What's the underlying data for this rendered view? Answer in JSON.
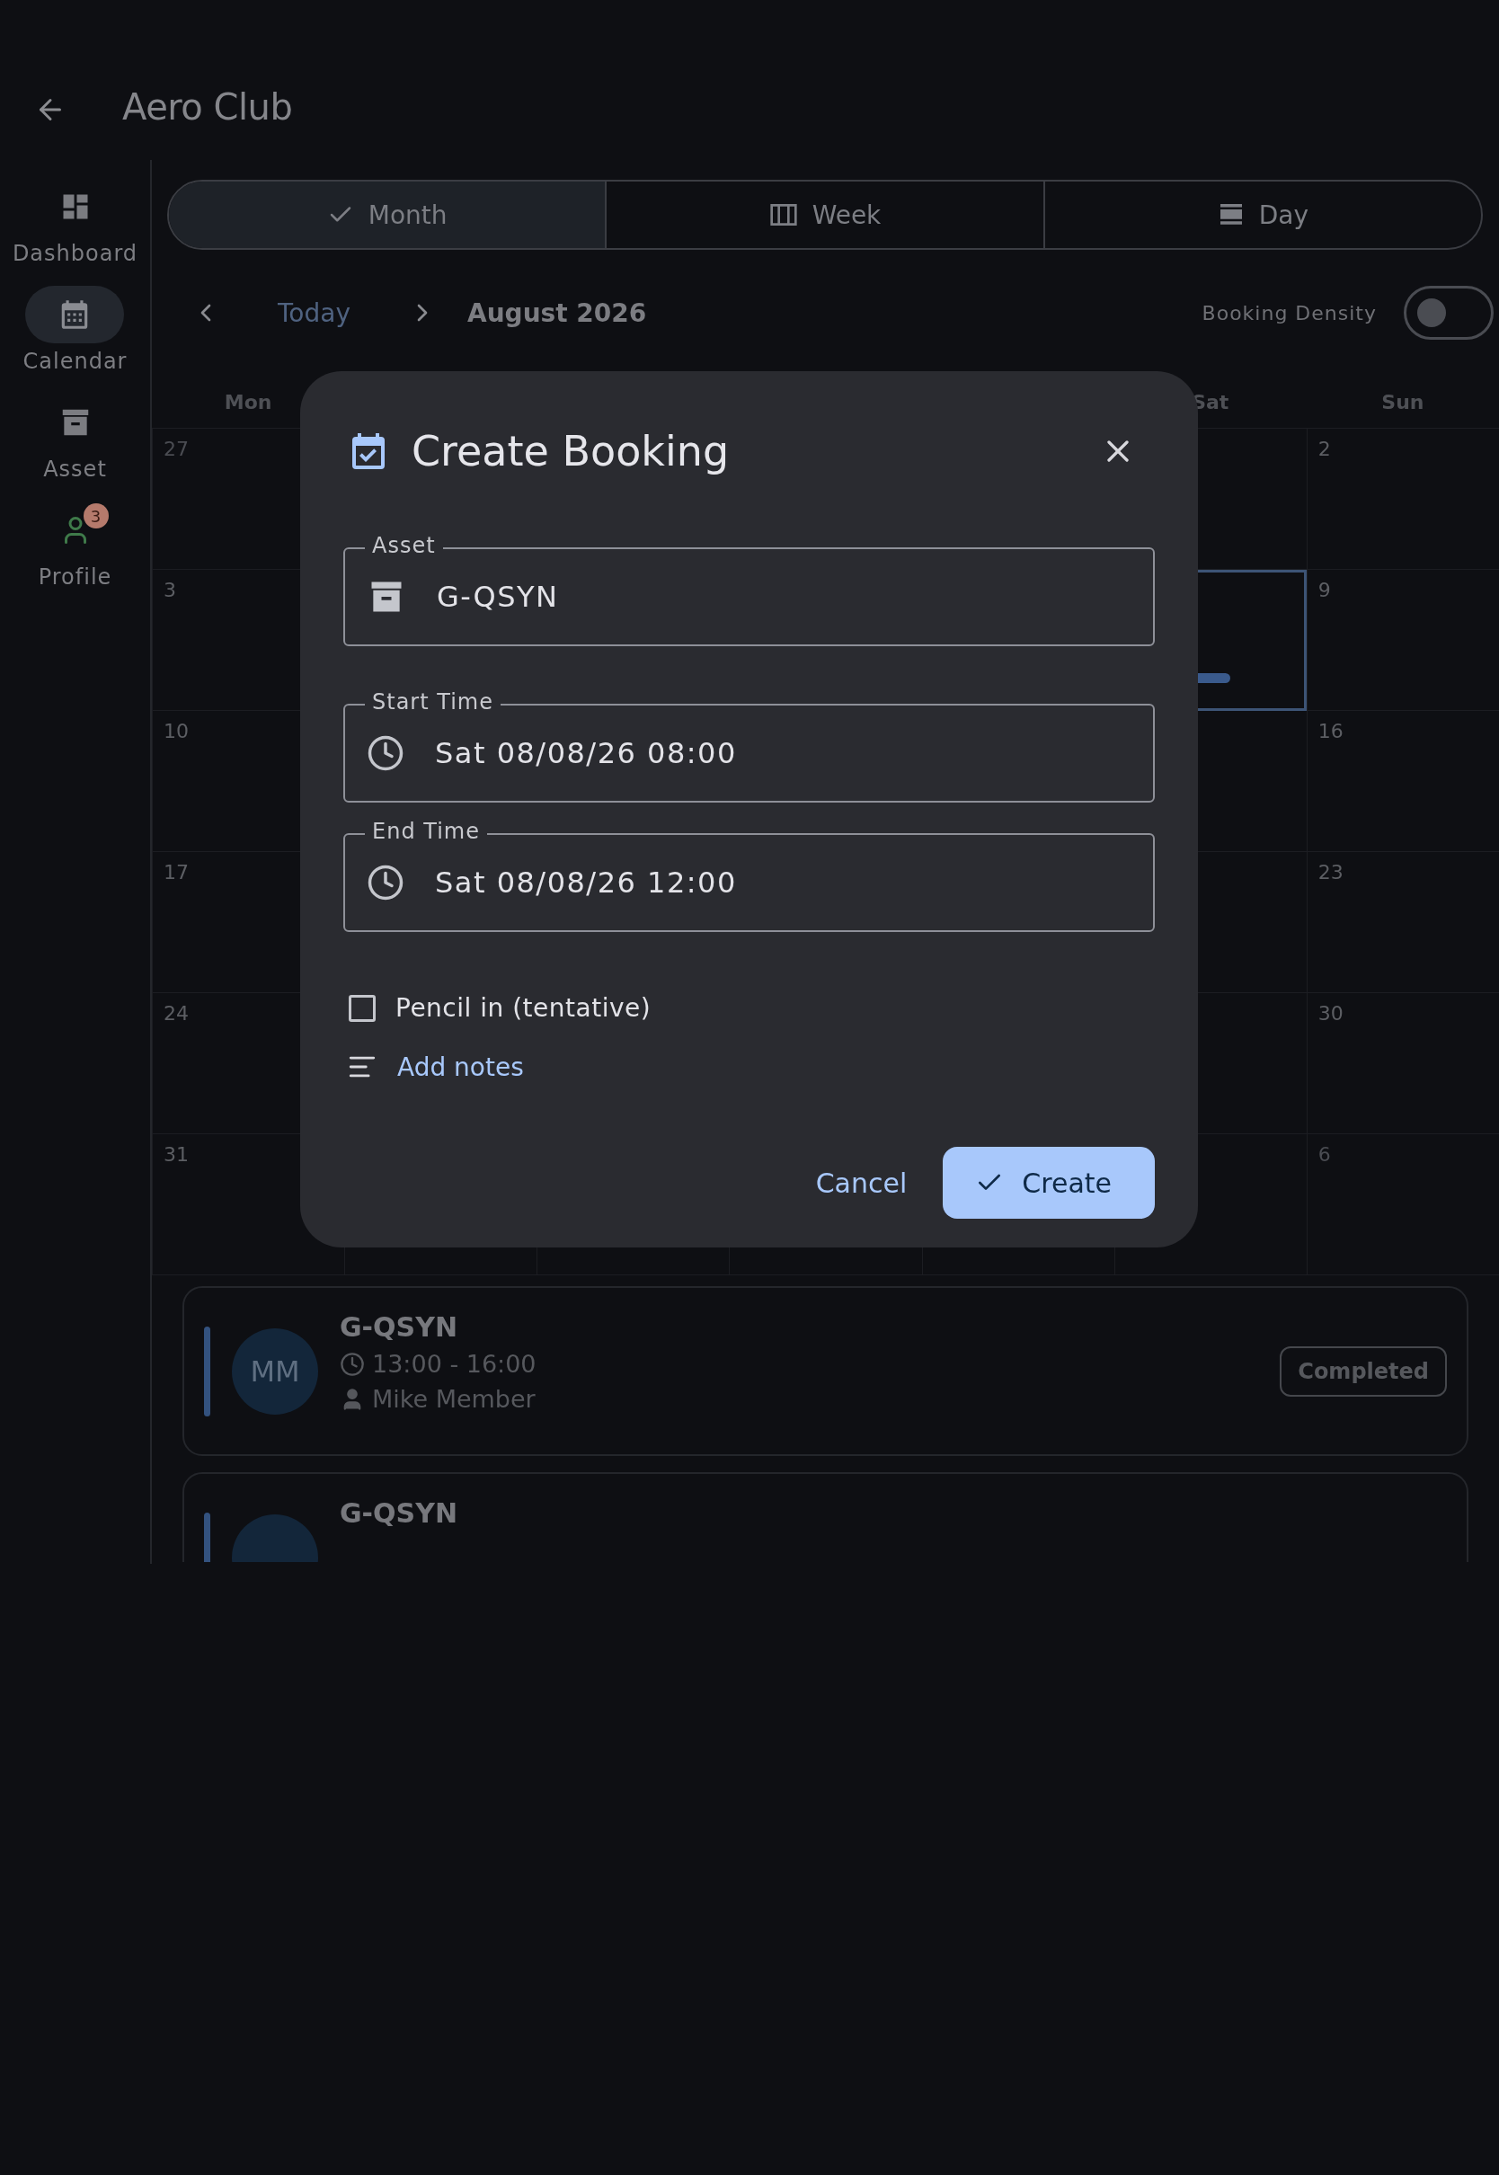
{
  "app_bar": {
    "title": "Aero Club"
  },
  "sidebar": {
    "items": [
      {
        "kind": "dashboard",
        "label": "Dashboard",
        "selected": false
      },
      {
        "kind": "calendar",
        "label": "Calendar",
        "selected": true
      },
      {
        "kind": "asset",
        "label": "Asset",
        "selected": false
      },
      {
        "kind": "profile",
        "label": "Profile",
        "selected": false,
        "badge": "3"
      }
    ]
  },
  "view_tabs": [
    {
      "label": "Month",
      "selected": true
    },
    {
      "kind": "week",
      "label": "Week",
      "selected": false
    },
    {
      "kind": "day",
      "label": "Day",
      "selected": false
    }
  ],
  "nav": {
    "today": "Today",
    "period": "August 2026"
  },
  "density_toggle": {
    "label": "Booking Density",
    "on": false
  },
  "calendar": {
    "headers": {
      "mon": "Mon",
      "sat": "Sat",
      "sun": "Sun"
    },
    "weeks": [
      {
        "mon": {
          "day": "27",
          "outside": true
        },
        "sun": {
          "day": "2",
          "outside": false
        }
      },
      {
        "mon": {
          "day": "3",
          "outside": false
        },
        "sat": {
          "selected": true,
          "has_booking": true
        },
        "sun": {
          "day": "9",
          "outside": false
        }
      },
      {
        "mon": {
          "day": "10",
          "outside": false
        },
        "sun": {
          "day": "16",
          "outside": false
        }
      },
      {
        "mon": {
          "day": "17",
          "outside": false
        },
        "sun": {
          "day": "23",
          "outside": false
        }
      },
      {
        "mon": {
          "day": "24",
          "outside": false
        },
        "sun": {
          "day": "30",
          "outside": false
        }
      },
      {
        "mon": {
          "day": "31",
          "outside": false
        },
        "sun": {
          "day": "6",
          "outside": true
        }
      }
    ]
  },
  "bookings": [
    {
      "asset": "G-QSYN",
      "initials": "MM",
      "time": "13:00 - 16:00",
      "member": "Mike Member",
      "status": "Completed"
    },
    {
      "asset": "G-QSYN"
    }
  ],
  "dialog": {
    "title": "Create Booking",
    "fields": [
      {
        "kind": "asset",
        "label": "Asset",
        "value": "G-QSYN"
      },
      {
        "kind": "time",
        "label": "Start Time",
        "value": "Sat 08/08/26 08:00"
      },
      {
        "kind": "time",
        "label": "End Time",
        "value": "Sat 08/08/26 12:00"
      }
    ],
    "tentative": {
      "label": "Pencil in (tentative)",
      "checked": false
    },
    "notes_link": "Add notes",
    "actions": {
      "cancel": "Cancel",
      "create": "Create"
    }
  }
}
